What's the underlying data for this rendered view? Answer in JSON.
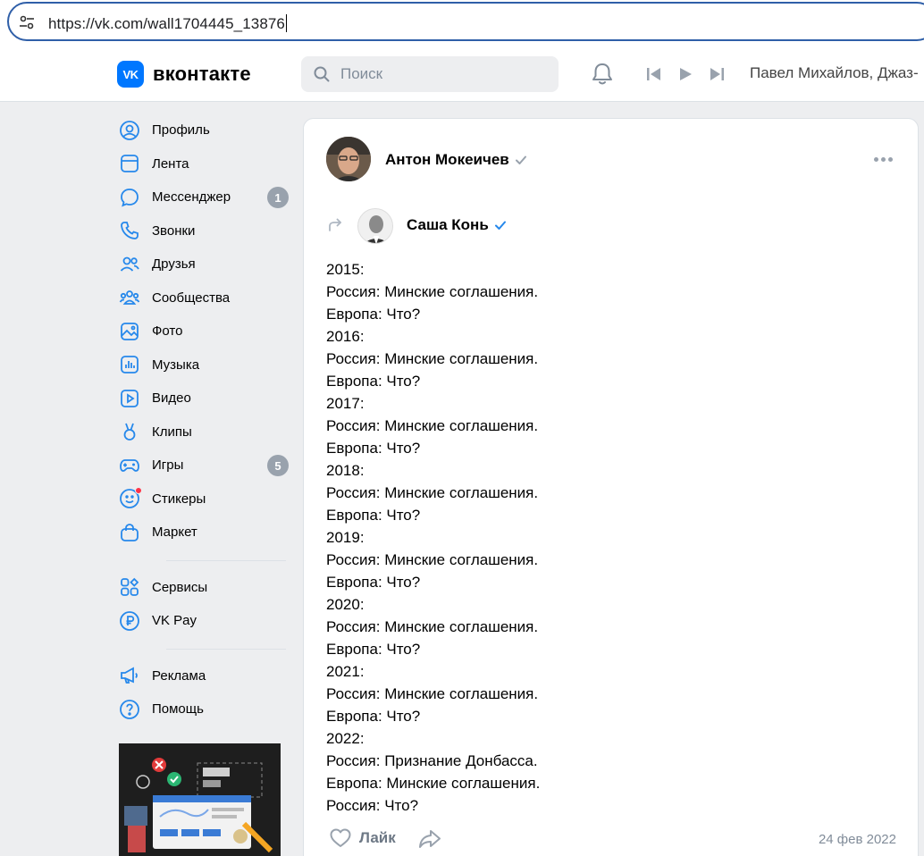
{
  "browser": {
    "url": "https://vk.com/wall1704445_13876"
  },
  "header": {
    "logo_badge": "VK",
    "logo_text": "вконтакте",
    "search_placeholder": "Поиск",
    "now_playing": "Павел Михайлов, Джаз-",
    "accent_color": "#0077ff"
  },
  "sidebar": {
    "items": [
      {
        "label": "Профиль",
        "icon": "profile-icon"
      },
      {
        "label": "Лента",
        "icon": "feed-icon"
      },
      {
        "label": "Мессенджер",
        "icon": "messenger-icon",
        "badge": "1"
      },
      {
        "label": "Звонки",
        "icon": "phone-icon"
      },
      {
        "label": "Друзья",
        "icon": "friends-icon"
      },
      {
        "label": "Сообщества",
        "icon": "communities-icon"
      },
      {
        "label": "Фото",
        "icon": "photo-icon"
      },
      {
        "label": "Музыка",
        "icon": "music-icon"
      },
      {
        "label": "Видео",
        "icon": "video-icon"
      },
      {
        "label": "Клипы",
        "icon": "clips-icon"
      },
      {
        "label": "Игры",
        "icon": "games-icon",
        "badge": "5"
      },
      {
        "label": "Стикеры",
        "icon": "stickers-icon"
      },
      {
        "label": "Маркет",
        "icon": "market-icon"
      }
    ],
    "items2": [
      {
        "label": "Сервисы",
        "icon": "services-icon"
      },
      {
        "label": "VK Pay",
        "icon": "vkpay-icon"
      }
    ],
    "items3": [
      {
        "label": "Реклама",
        "icon": "ads-icon"
      },
      {
        "label": "Помощь",
        "icon": "help-icon"
      }
    ]
  },
  "post": {
    "author": "Антон Мокеичев",
    "repost_author": "Саша Конь",
    "lines": [
      "2015:",
      "Россия: Минские соглашения.",
      "Европа: Что?",
      "2016:",
      "Россия: Минские соглашения.",
      "Европа: Что?",
      "2017:",
      "Россия: Минские соглашения.",
      "Европа: Что?",
      "2018:",
      "Россия: Минские соглашения.",
      "Европа: Что?",
      "2019:",
      "Россия: Минские соглашения.",
      "Европа: Что?",
      "2020:",
      "Россия: Минские соглашения.",
      "Европа: Что?",
      "2021:",
      "Россия: Минские соглашения.",
      "Европа: Что?",
      "2022:",
      "Россия: Признание Донбасса.",
      "Европа: Минские соглашения.",
      "Россия: Что?"
    ],
    "like_label": "Лайк",
    "date": "24 фев 2022"
  }
}
